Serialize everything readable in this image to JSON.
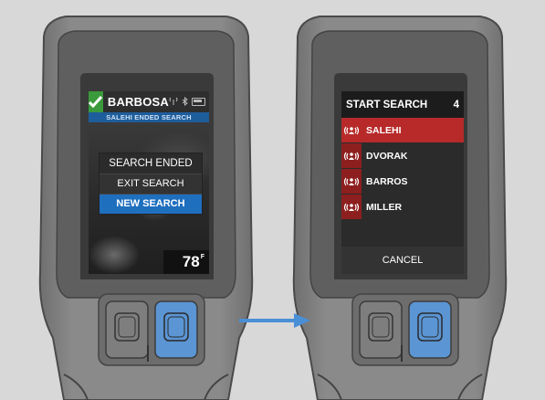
{
  "left_device": {
    "user_name": "BARBOSA",
    "banner_text": "SALEHI ENDED SEARCH",
    "menu": {
      "title": "SEARCH ENDED",
      "items": [
        "EXIT SEARCH",
        "NEW SEARCH"
      ],
      "selected_index": 1
    },
    "temperature": "78",
    "temperature_unit": "F"
  },
  "right_device": {
    "title": "START SEARCH",
    "count": "4",
    "people": [
      {
        "name": "SALEHI",
        "selected": true
      },
      {
        "name": "DVORAK",
        "selected": false
      },
      {
        "name": "BARROS",
        "selected": false
      },
      {
        "name": "MILLER",
        "selected": false
      }
    ],
    "cancel_label": "CANCEL"
  },
  "colors": {
    "background": "#d8d8d8",
    "device_body": "#7e7e7e",
    "accent_blue": "#1f6fbf",
    "accent_red": "#b82a2a",
    "check_green": "#3b9a3b",
    "arrow_blue": "#4a8fd6"
  },
  "icons": {
    "status_ok": "checkmark-icon",
    "signal": "signal-icon",
    "bluetooth": "bluetooth-icon",
    "battery": "battery-icon",
    "person_beacon": "person-beacon-icon",
    "transition": "right-arrow-icon"
  }
}
